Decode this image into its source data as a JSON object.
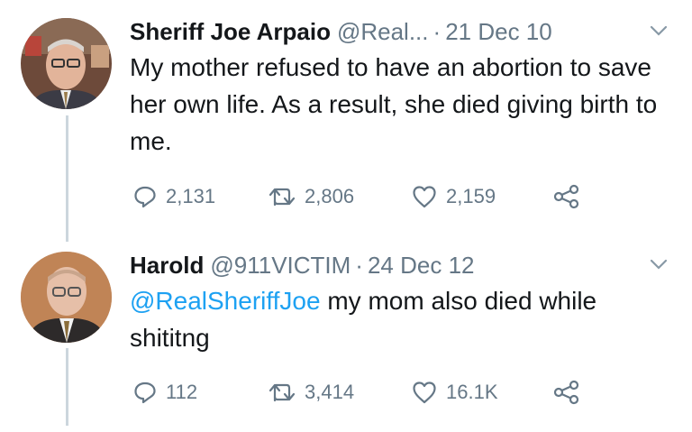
{
  "tweets": [
    {
      "name": "Sheriff Joe Arpaio",
      "handle": "@Real...",
      "separator": "·",
      "date": "21 Dec 10",
      "text": "My mother refused to have an abortion to save her own life. As a result, she died giving birth to me.",
      "replies": "2,131",
      "retweets": "2,806",
      "likes": "2,159"
    },
    {
      "name": "Harold",
      "handle": "@911VICTIM",
      "separator": "·",
      "date": "24 Dec 12",
      "mention": "@RealSheriffJoe",
      "text": " my mom also died while shititng",
      "replies": "112",
      "retweets": "3,414",
      "likes": "16.1K"
    }
  ],
  "colors": {
    "text": "#14171a",
    "secondary": "#657786",
    "link": "#1da1f2",
    "thread_line": "#ccd6dd"
  },
  "icons": [
    "reply-icon",
    "retweet-icon",
    "like-icon",
    "share-icon",
    "chevron-down-icon"
  ]
}
